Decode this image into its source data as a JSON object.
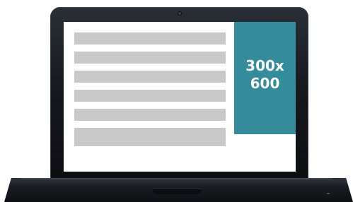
{
  "screen": {
    "ad_label": "300x 600",
    "ad_color": "#338b9b",
    "content_line_color": "#c9c9c9",
    "content_lines": [
      1,
      2,
      3,
      4,
      5,
      6
    ]
  },
  "device": {
    "type": "laptop",
    "frame_color": "#15181d"
  }
}
